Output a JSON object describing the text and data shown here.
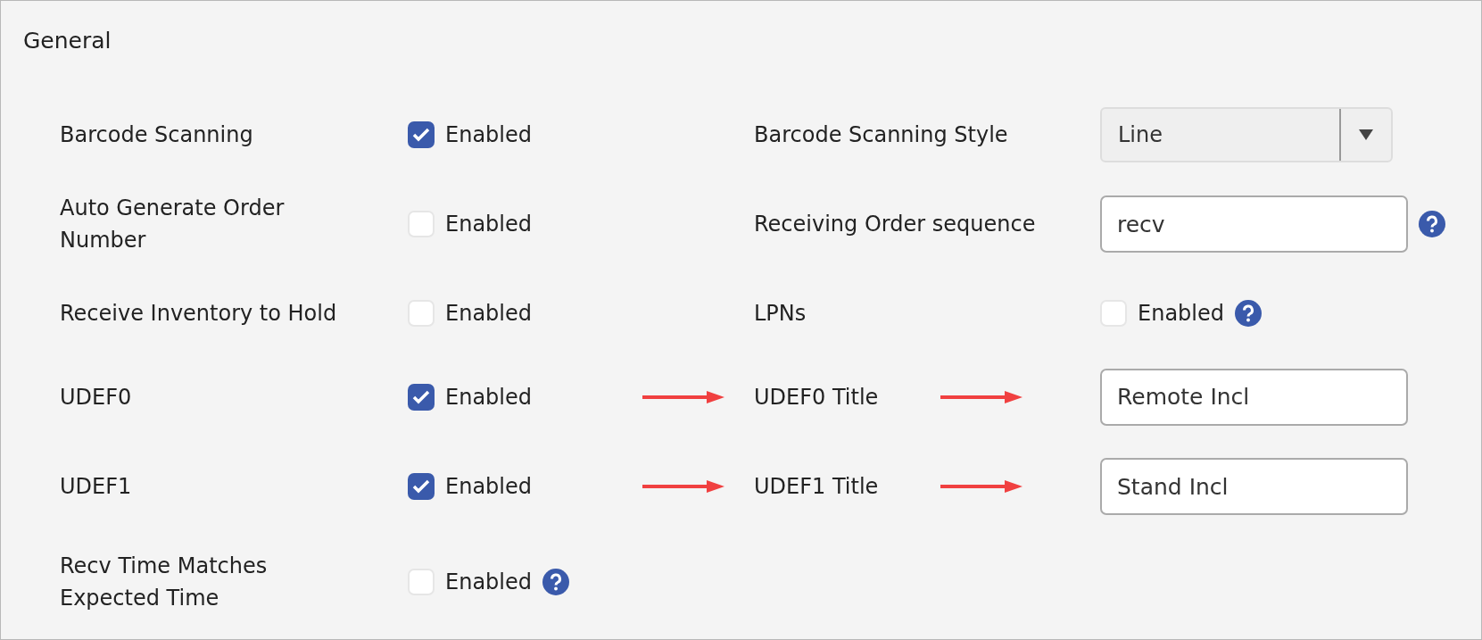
{
  "section": {
    "title": "General"
  },
  "rows": [
    {
      "label": "Barcode Scanning",
      "checkbox": {
        "label": "Enabled",
        "checked": true,
        "help": false
      },
      "annotated": false,
      "right": {
        "kind": "select",
        "label": "Barcode Scanning Style",
        "value": "Line",
        "help": false
      }
    },
    {
      "label": "Auto Generate Order Number",
      "checkbox": {
        "label": "Enabled",
        "checked": false,
        "help": false
      },
      "annotated": false,
      "right": {
        "kind": "input",
        "label": "Receiving Order sequence",
        "value": "recv",
        "help": true
      }
    },
    {
      "label": "Receive Inventory to Hold",
      "checkbox": {
        "label": "Enabled",
        "checked": false,
        "help": false
      },
      "annotated": false,
      "right": {
        "kind": "checkbox",
        "label": "LPNs",
        "value": "Enabled",
        "checked": false,
        "help": true
      }
    },
    {
      "label": "UDEF0",
      "checkbox": {
        "label": "Enabled",
        "checked": true,
        "help": false
      },
      "annotated": true,
      "right": {
        "kind": "input",
        "label": "UDEF0 Title",
        "value": "Remote Incl",
        "help": false
      }
    },
    {
      "label": "UDEF1",
      "checkbox": {
        "label": "Enabled",
        "checked": true,
        "help": false
      },
      "annotated": true,
      "right": {
        "kind": "input",
        "label": "UDEF1 Title",
        "value": "Stand Incl",
        "help": false
      }
    },
    {
      "label": "Recv Time Matches Expected Time",
      "checkbox": {
        "label": "Enabled",
        "checked": false,
        "help": true
      },
      "annotated": false
    }
  ]
}
